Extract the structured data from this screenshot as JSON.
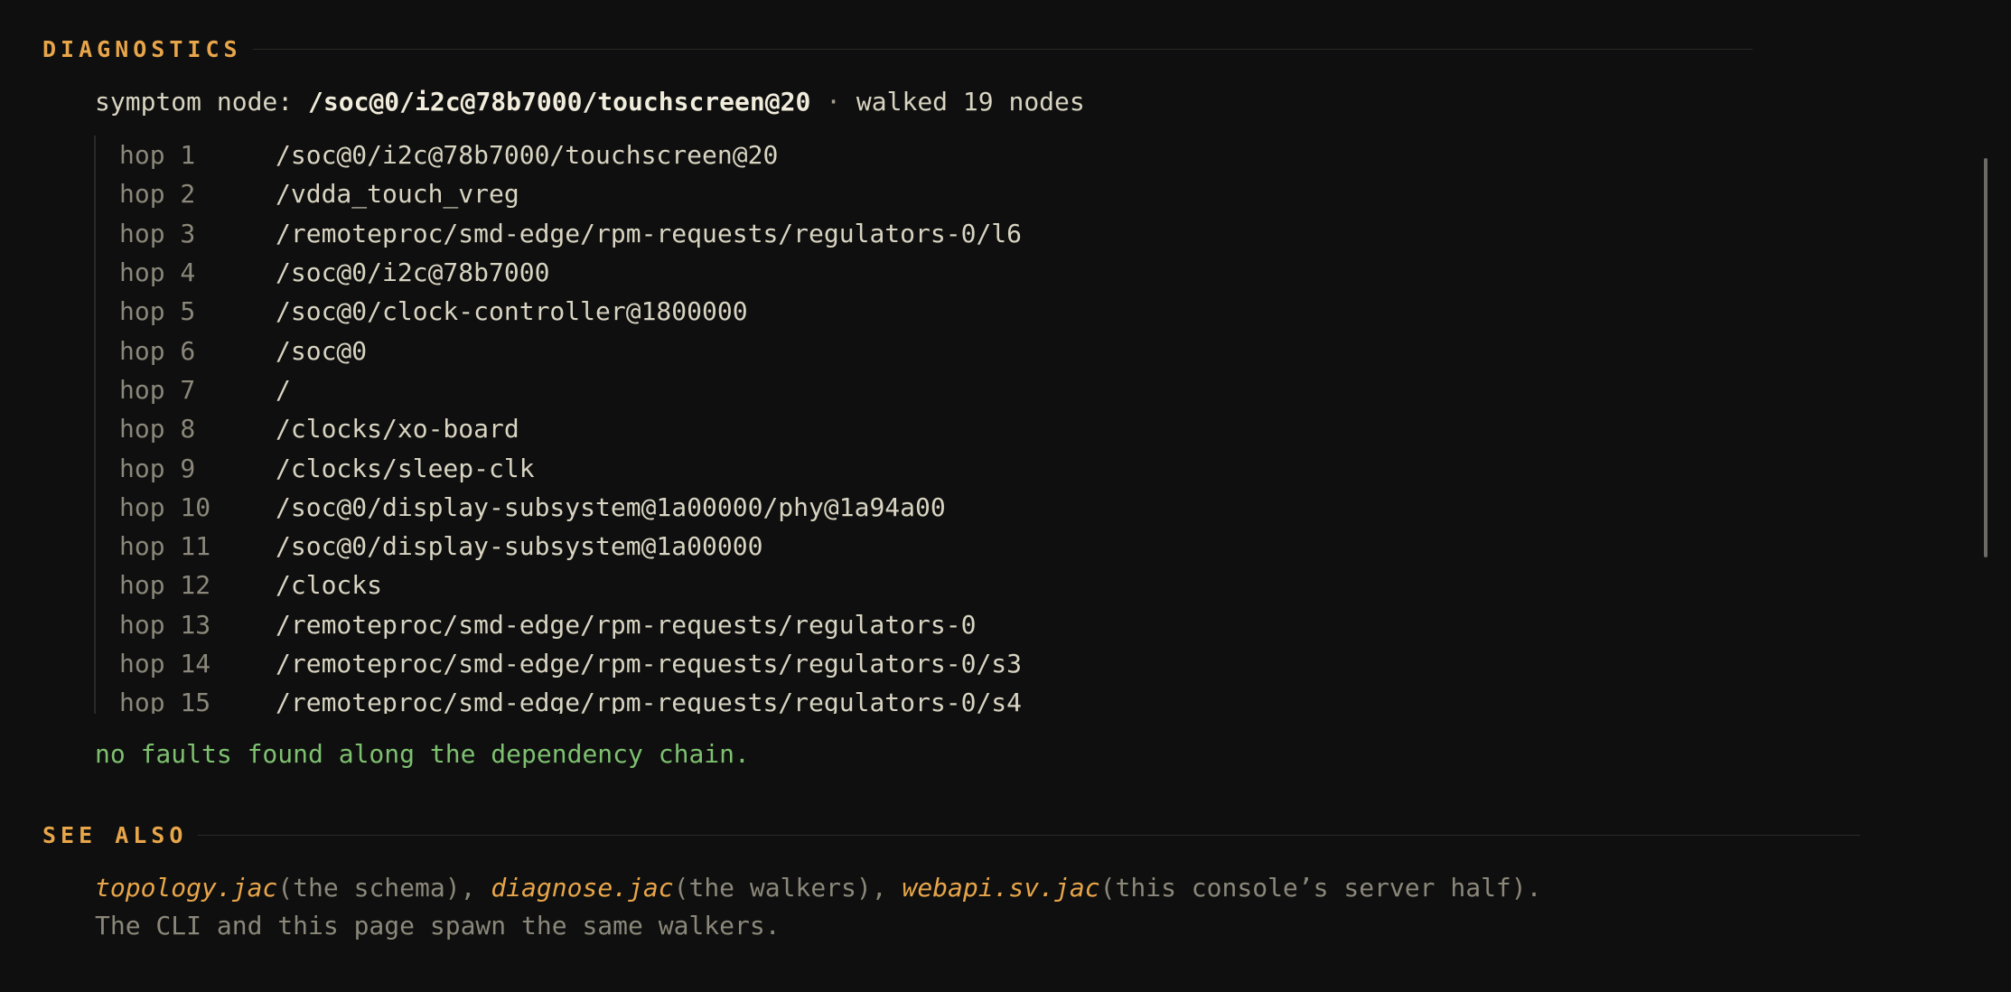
{
  "diagnostics": {
    "title": "DIAGNOSTICS",
    "symptom_prefix": "symptom node: ",
    "symptom_node": "/soc@0/i2c@78b7000/touchscreen@20",
    "separator": " · ",
    "walked": "walked 19 nodes",
    "hops": [
      {
        "label": "hop 1",
        "path": "/soc@0/i2c@78b7000/touchscreen@20"
      },
      {
        "label": "hop 2",
        "path": "/vdda_touch_vreg"
      },
      {
        "label": "hop 3",
        "path": "/remoteproc/smd-edge/rpm-requests/regulators-0/l6"
      },
      {
        "label": "hop 4",
        "path": "/soc@0/i2c@78b7000"
      },
      {
        "label": "hop 5",
        "path": "/soc@0/clock-controller@1800000"
      },
      {
        "label": "hop 6",
        "path": "/soc@0"
      },
      {
        "label": "hop 7",
        "path": "/"
      },
      {
        "label": "hop 8",
        "path": "/clocks/xo-board"
      },
      {
        "label": "hop 9",
        "path": "/clocks/sleep-clk"
      },
      {
        "label": "hop 10",
        "path": "/soc@0/display-subsystem@1a00000/phy@1a94a00"
      },
      {
        "label": "hop 11",
        "path": "/soc@0/display-subsystem@1a00000"
      },
      {
        "label": "hop 12",
        "path": "/clocks"
      },
      {
        "label": "hop 13",
        "path": "/remoteproc/smd-edge/rpm-requests/regulators-0"
      },
      {
        "label": "hop 14",
        "path": "/remoteproc/smd-edge/rpm-requests/regulators-0/s3"
      },
      {
        "label": "hop 15",
        "path": "/remoteproc/smd-edge/rpm-requests/regulators-0/s4"
      }
    ],
    "result": "no faults found along the dependency chain."
  },
  "see_also": {
    "title": "SEE ALSO",
    "links": [
      {
        "file": "topology.jac",
        "desc": "(the schema)",
        "after": ", "
      },
      {
        "file": "diagnose.jac",
        "desc": "(the walkers)",
        "after": ", "
      },
      {
        "file": "webapi.sv.jac",
        "desc": "(this console’s server half)",
        "after": "."
      }
    ],
    "note": "The CLI and this page spawn the same walkers."
  },
  "colors": {
    "background": "#0e0f0e",
    "accent": "#e8a54a",
    "success": "#7ec070",
    "text": "#d9d4c2",
    "muted": "#8b877a"
  }
}
